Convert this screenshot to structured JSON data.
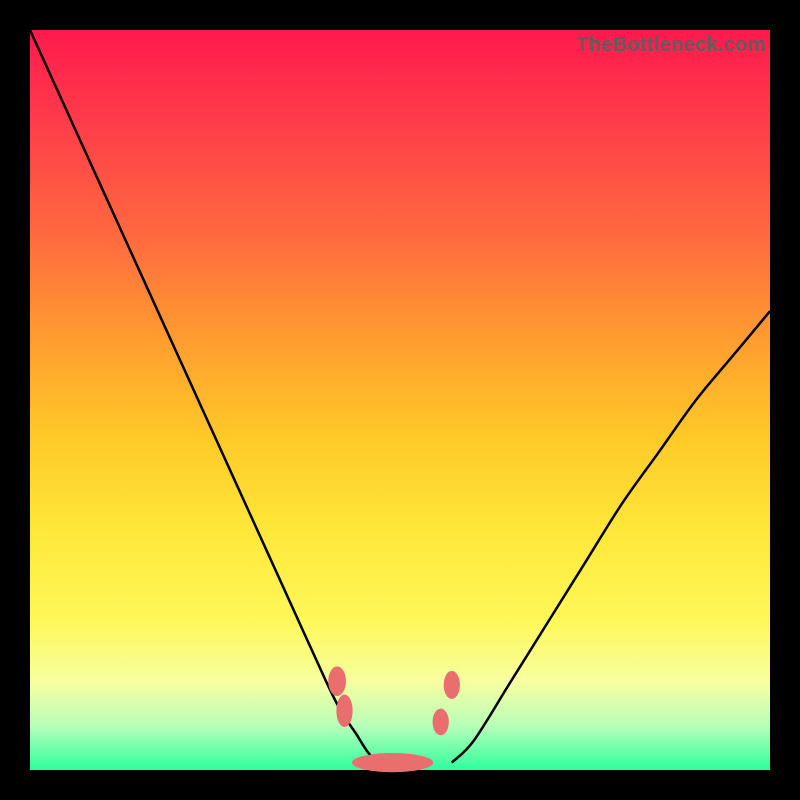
{
  "watermark": "TheBottleneck.com",
  "colors": {
    "frame": "#000000",
    "gradient_stops": [
      "#ff1a4d",
      "#ff3b4a",
      "#ff6a3f",
      "#ff9d2f",
      "#ffc928",
      "#ffe83a",
      "#fff85a",
      "#f7ffa0",
      "#b9ffb9",
      "#2fff9e"
    ],
    "curve": "#000000",
    "marker": "#e96f6f"
  },
  "chart_data": {
    "type": "line",
    "title": "",
    "xlabel": "",
    "ylabel": "",
    "xlim": [
      0,
      100
    ],
    "ylim": [
      0,
      100
    ],
    "series": [
      {
        "name": "left-branch",
        "x": [
          0,
          5,
          10,
          15,
          20,
          25,
          30,
          35,
          40,
          42,
          44,
          46,
          48
        ],
        "y": [
          100,
          89,
          78,
          67,
          56,
          45,
          34,
          23,
          12,
          8,
          5,
          2,
          1
        ]
      },
      {
        "name": "right-branch",
        "x": [
          57,
          60,
          65,
          70,
          75,
          80,
          85,
          90,
          95,
          100
        ],
        "y": [
          1,
          4,
          12,
          20,
          28,
          36,
          43,
          50,
          56,
          62
        ]
      }
    ],
    "markers": [
      {
        "name": "left-upper-blob",
        "x": 41.5,
        "y": 12.0,
        "rx": 1.2,
        "ry": 2.0
      },
      {
        "name": "left-lower-blob",
        "x": 42.5,
        "y": 8.0,
        "rx": 1.1,
        "ry": 2.2
      },
      {
        "name": "bottom-blob",
        "x": 49.0,
        "y": 1.0,
        "rx": 5.5,
        "ry": 1.3
      },
      {
        "name": "right-lower-blob",
        "x": 55.5,
        "y": 6.5,
        "rx": 1.1,
        "ry": 1.8
      },
      {
        "name": "right-upper-blob",
        "x": 57.0,
        "y": 11.5,
        "rx": 1.1,
        "ry": 1.9
      }
    ],
    "background_gradient": {
      "top_color": "#ff1a4d",
      "bottom_color": "#2fff9e",
      "meaning": "qualitative heat scale (red=bad, green=good)"
    }
  }
}
